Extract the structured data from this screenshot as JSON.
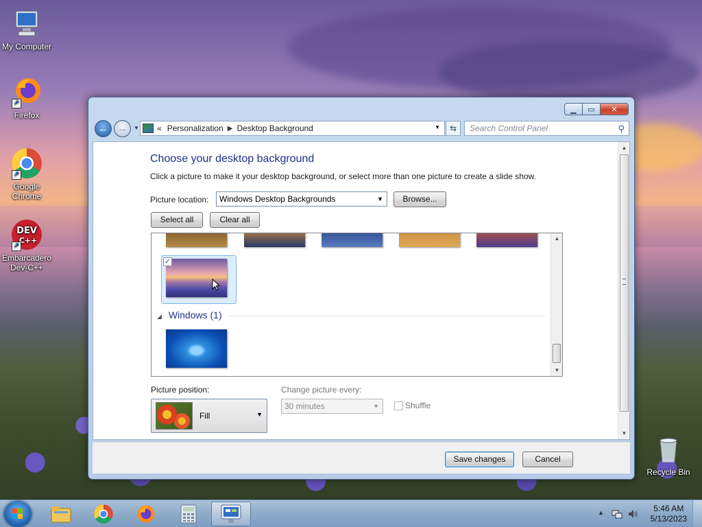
{
  "desktop": {
    "icons": [
      {
        "label": "My Computer"
      },
      {
        "label": "Firefox"
      },
      {
        "label": "Google Chrome"
      },
      {
        "label": "Embarcadero Dev-C++"
      },
      {
        "label": "Recycle Bin"
      }
    ]
  },
  "window": {
    "address": {
      "prefix": "«",
      "crumbs": [
        "Personalization",
        "Desktop Background"
      ]
    },
    "search_placeholder": "Search Control Panel",
    "heading": "Choose your desktop background",
    "subtext": "Click a picture to make it your desktop background, or select more than one picture to create a slide show.",
    "picture_location_label": "Picture location:",
    "picture_location_value": "Windows Desktop Backgrounds",
    "browse_label": "Browse...",
    "select_all_label": "Select all",
    "clear_all_label": "Clear all",
    "group_windows": "Windows (1)",
    "picture_position_label": "Picture position:",
    "picture_position_value": "Fill",
    "change_every_label": "Change picture every:",
    "change_every_value": "30 minutes",
    "shuffle_label": "Shuffle",
    "save_label": "Save changes",
    "cancel_label": "Cancel",
    "checkbox_mark": "✓"
  },
  "taskbar": {
    "time": "5:46 AM",
    "date": "5/13/2023"
  },
  "colors": {
    "heading": "#1e3287",
    "window_frame": "#b7cce6",
    "close_button": "#c9432b"
  }
}
